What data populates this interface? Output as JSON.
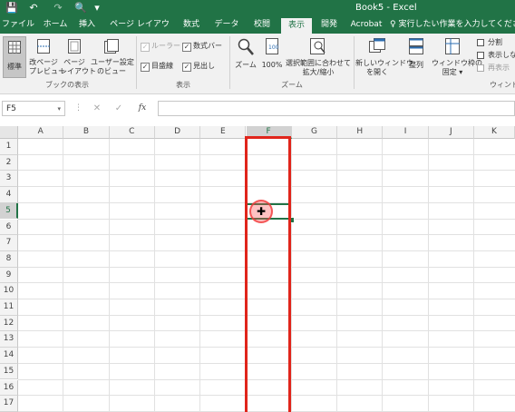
{
  "window": {
    "title": "Book5 - Excel"
  },
  "quick_access": {
    "save_icon": "💾",
    "undo_icon": "↶",
    "redo_icon": "↷",
    "preview_icon": "🔍",
    "more_icon": "▾"
  },
  "tabs": [
    "ファイル",
    "ホーム",
    "挿入",
    "ページ レイアウト",
    "数式",
    "データ",
    "校閲",
    "表示",
    "開発",
    "Acrobat"
  ],
  "active_tab": "表示",
  "tell_me": "実行したい作業を入力してください",
  "ribbon": {
    "book_views": {
      "group_label": "ブックの表示",
      "normal": "標準",
      "page_break": [
        "改ページ",
        "プレビュー"
      ],
      "page_layout": [
        "ページ",
        "レイアウト"
      ],
      "custom_views": [
        "ユーザー設定",
        "のビュー"
      ]
    },
    "show": {
      "group_label": "表示",
      "ruler": "ルーラー",
      "formula_bar": "数式バー",
      "gridlines": "目盛線",
      "headings": "見出し"
    },
    "zoom": {
      "group_label": "ズーム",
      "zoom": "ズーム",
      "hundred": "100%",
      "selection": [
        "選択範囲に合わせて",
        "拡大/縮小"
      ]
    },
    "window": {
      "group_label": "ウィンド",
      "new_window": [
        "新しいウィンドウ",
        "を開く"
      ],
      "arrange": "整列",
      "freeze": [
        "ウィンドウ枠の",
        "固定 ▾"
      ],
      "split": "分割",
      "hide": "表示しな",
      "unhide": "再表示"
    }
  },
  "formula_bar": {
    "name_box": "F5",
    "cancel": "✕",
    "enter": "✓",
    "fx": "fx",
    "value": ""
  },
  "columns": [
    "A",
    "B",
    "C",
    "D",
    "E",
    "F",
    "G",
    "H",
    "I",
    "J",
    "K"
  ],
  "rows": [
    "1",
    "2",
    "3",
    "4",
    "5",
    "6",
    "7",
    "8",
    "9",
    "10",
    "11",
    "12",
    "13",
    "14",
    "15",
    "16",
    "17"
  ],
  "selected_cell": {
    "column": "F",
    "row": "5"
  },
  "colors": {
    "excel_green": "#217346",
    "highlight_red": "#e0251b"
  }
}
